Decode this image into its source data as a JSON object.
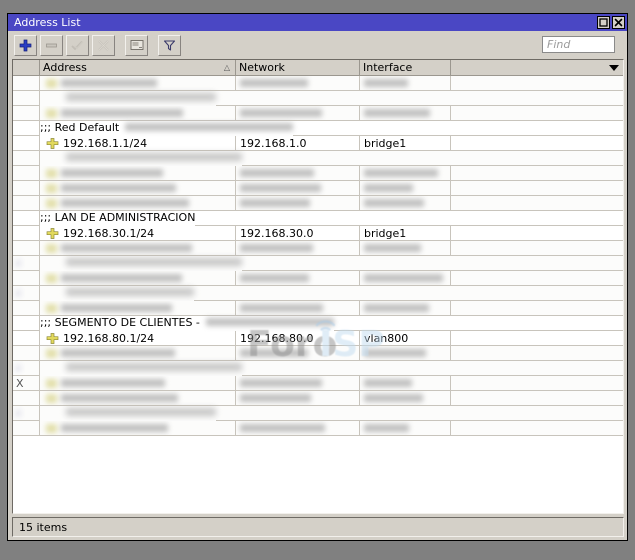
{
  "window": {
    "title": "Address List",
    "buttons": {
      "maximize": "maximize-icon",
      "close": "close-icon"
    }
  },
  "toolbar": {
    "items": [
      {
        "name": "add-button",
        "icon": "plus-icon",
        "enabled": true
      },
      {
        "name": "remove-button",
        "icon": "minus-icon",
        "enabled": false
      },
      {
        "name": "enable-button",
        "icon": "check-icon",
        "enabled": false
      },
      {
        "name": "disable-button",
        "icon": "cross-icon",
        "enabled": false
      },
      {
        "name": "comment-button",
        "icon": "comment-icon",
        "enabled": true
      },
      {
        "name": "filter-button",
        "icon": "funnel-icon",
        "enabled": true
      }
    ],
    "find_placeholder": "Find"
  },
  "table": {
    "columns": [
      {
        "label": "",
        "key": "gutter"
      },
      {
        "label": "Address",
        "key": "address",
        "sorted": "asc",
        "sort_glyph": "△"
      },
      {
        "label": "Network",
        "key": "network"
      },
      {
        "label": "Interface",
        "key": "interface"
      },
      {
        "label": "",
        "key": "extra",
        "menu": "chevron-down-icon"
      }
    ],
    "rows": [
      {
        "type": "data",
        "redacted": true,
        "marker": "",
        "address": "",
        "network": "",
        "interface": ""
      },
      {
        "type": "comment",
        "redacted": true,
        "marker": "",
        "comment": ""
      },
      {
        "type": "data",
        "redacted": true,
        "marker": "",
        "address": "",
        "network": "",
        "interface": ""
      },
      {
        "type": "comment",
        "redacted": false,
        "marker": ";;;",
        "comment": "Red Default",
        "comment_tail_redacted": true
      },
      {
        "type": "data",
        "redacted": false,
        "marker": "",
        "address": "192.168.1.1/24",
        "network": "192.168.1.0",
        "interface": "bridge1"
      },
      {
        "type": "comment",
        "redacted": true,
        "marker": "",
        "comment": ""
      },
      {
        "type": "data",
        "redacted": true,
        "marker": "",
        "address": "",
        "network": "",
        "interface": ""
      },
      {
        "type": "data",
        "redacted": true,
        "marker": "",
        "address": "",
        "network": "",
        "interface": ""
      },
      {
        "type": "data",
        "redacted": true,
        "marker": "",
        "address": "",
        "network": "",
        "interface": ""
      },
      {
        "type": "comment",
        "redacted": false,
        "marker": ";;;",
        "comment": "LAN DE ADMINISTRACION"
      },
      {
        "type": "data",
        "redacted": false,
        "marker": "",
        "address": "192.168.30.1/24",
        "network": "192.168.30.0",
        "interface": "bridge1"
      },
      {
        "type": "data",
        "redacted": true,
        "marker": "",
        "address": "",
        "network": "",
        "interface": ""
      },
      {
        "type": "comment",
        "redacted": true,
        "marker": ";;",
        "comment": ""
      },
      {
        "type": "data",
        "redacted": true,
        "marker": "",
        "address": "",
        "network": "",
        "interface": ""
      },
      {
        "type": "comment",
        "redacted": true,
        "marker": ";;",
        "comment": ""
      },
      {
        "type": "data",
        "redacted": true,
        "marker": "",
        "address": "",
        "network": "",
        "interface": ""
      },
      {
        "type": "comment",
        "redacted": false,
        "marker": ";;;",
        "comment": "SEGMENTO DE CLIENTES -",
        "comment_tail_redacted": true
      },
      {
        "type": "data",
        "redacted": false,
        "marker": "",
        "address": "192.168.80.1/24",
        "network": "192.168.80.0",
        "interface": "vlan800"
      },
      {
        "type": "data",
        "redacted": true,
        "marker": "",
        "address": "",
        "network": "",
        "interface": ""
      },
      {
        "type": "comment",
        "redacted": true,
        "marker": ";;",
        "comment": ""
      },
      {
        "type": "data",
        "redacted": true,
        "marker": "X",
        "address": "",
        "network": "",
        "interface": ""
      },
      {
        "type": "data",
        "redacted": true,
        "marker": "",
        "address": "",
        "network": "",
        "interface": ""
      },
      {
        "type": "comment",
        "redacted": true,
        "marker": ";;",
        "comment": ""
      },
      {
        "type": "data",
        "redacted": true,
        "marker": "",
        "address": "",
        "network": "",
        "interface": ""
      }
    ]
  },
  "watermark": {
    "text_primary": "Foro",
    "text_secondary": "ISP"
  },
  "statusbar": {
    "count_text": "15 items"
  },
  "colors": {
    "titlebar": "#4a47c4",
    "window_face": "#d4d0c8",
    "desktop": "#808080",
    "grid_line": "#c8c4bc",
    "watermark_gray": "#8f8f8f",
    "watermark_blue": "#bdd7ee",
    "address_icon": "#d4c84a"
  }
}
